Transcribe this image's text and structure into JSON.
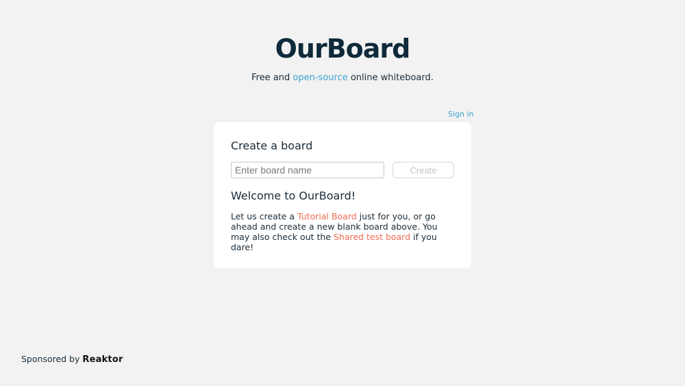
{
  "header": {
    "logo": "OurBoard",
    "tagline_prefix": "Free and ",
    "tagline_link": "open-source",
    "tagline_suffix": " online whiteboard."
  },
  "auth": {
    "signin_label": "Sign in"
  },
  "create_board": {
    "title": "Create a board",
    "input_placeholder": "Enter board name",
    "input_value": "",
    "button_label": "Create"
  },
  "welcome": {
    "title": "Welcome to OurBoard!",
    "text_1": "Let us create a ",
    "tutorial_link": "Tutorial Board",
    "text_2": " just for you, or go ahead and create a new blank board above. You may also check out the ",
    "shared_link": "Shared test board",
    "text_3": " if you dare!"
  },
  "footer": {
    "sponsored_by": "Sponsored by ",
    "sponsor_name": "Reaktor"
  },
  "colors": {
    "background": "#f2f2f2",
    "logo": "#0e2a3b",
    "link_blue": "#3aa3cf",
    "link_orange": "#f06a52",
    "card": "#ffffff"
  }
}
